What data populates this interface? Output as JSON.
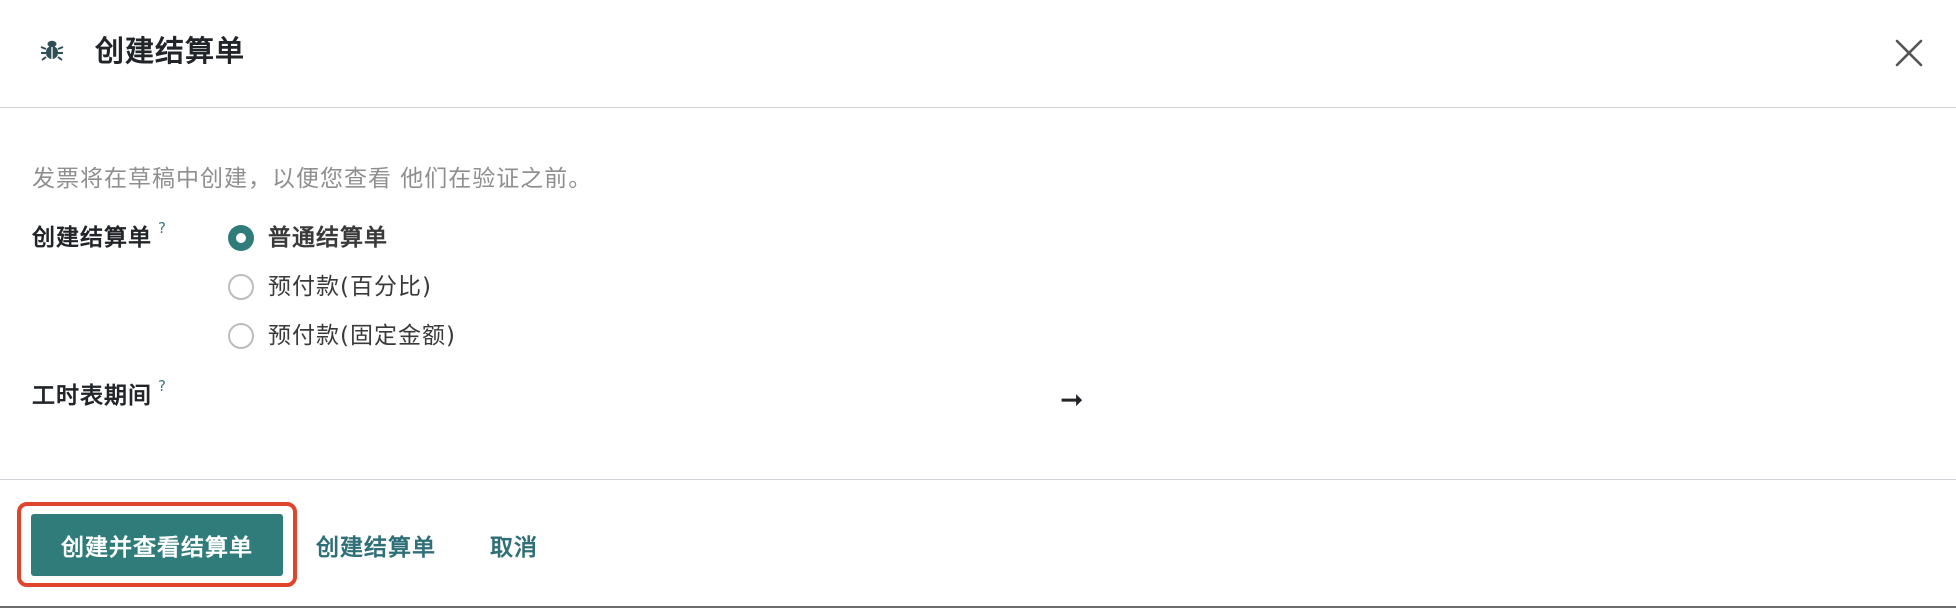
{
  "dialog": {
    "title": "创建结算单",
    "icon": "bug-icon",
    "close_icon": "close-icon"
  },
  "form": {
    "note": "发票将在草稿中创建，以便您查看 他们在验证之前。",
    "invoice_type": {
      "label": "创建结算单",
      "help": "?",
      "options": [
        {
          "label": "普通结算单",
          "selected": true
        },
        {
          "label": "预付款(百分比)",
          "selected": false
        },
        {
          "label": "预付款(固定金额)",
          "selected": false
        }
      ]
    },
    "timesheet_period": {
      "label": "工时表期间",
      "help": "?",
      "separator": "➞"
    }
  },
  "footer": {
    "primary_label": "创建并查看结算单",
    "create_label": "创建结算单",
    "cancel_label": "取消"
  },
  "colors": {
    "accent": "#2f7c7b",
    "highlight": "#e0442c"
  }
}
